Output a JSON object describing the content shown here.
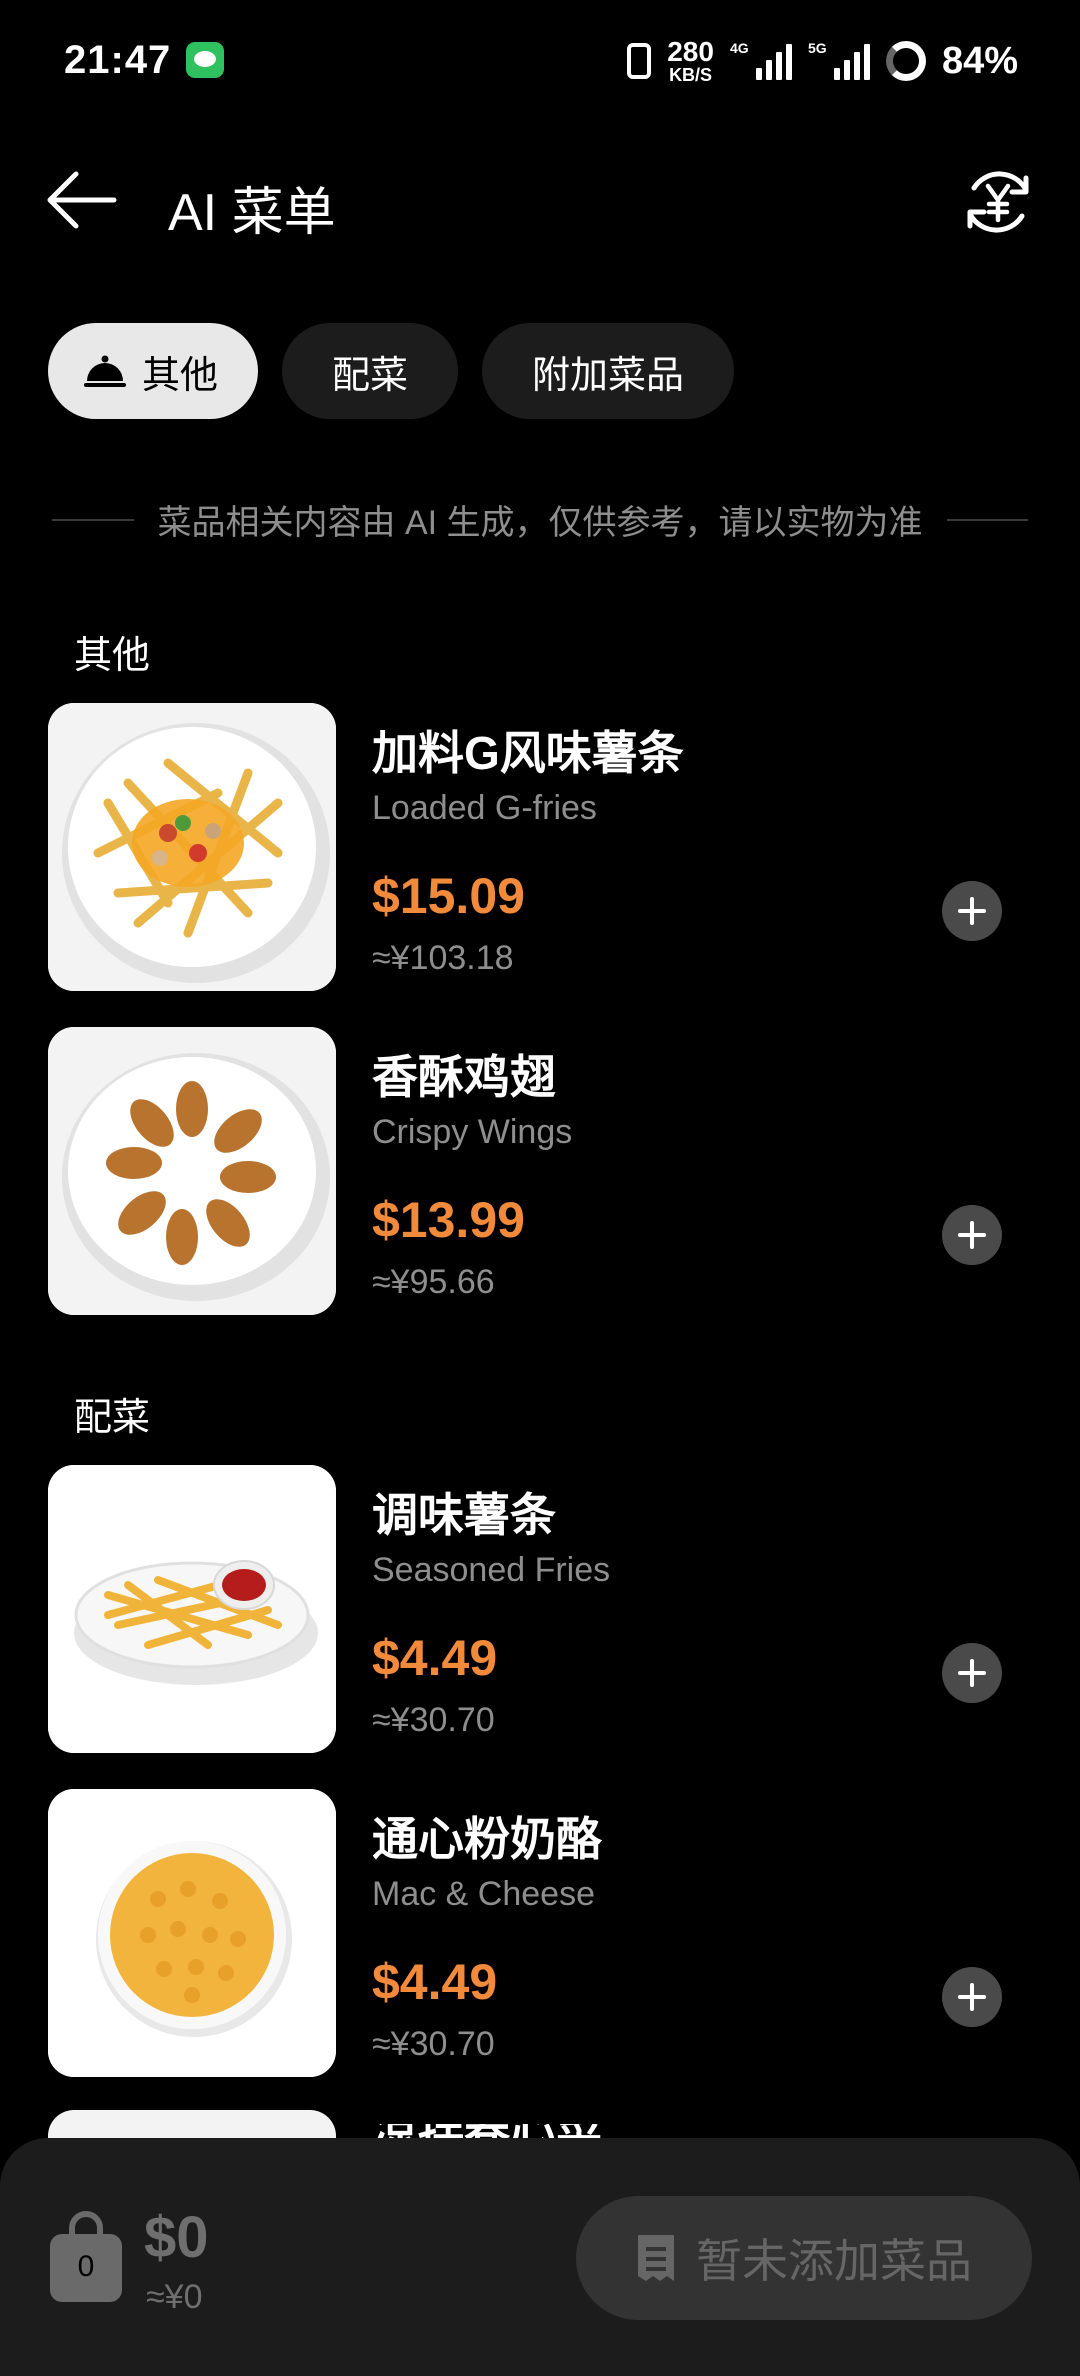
{
  "status_bar": {
    "time": "21:47",
    "net_speed": "280",
    "net_speed_unit": "KB/S",
    "sig1_label": "4G",
    "sig2_label": "5G",
    "battery": "84%"
  },
  "header": {
    "title": "AI 菜单"
  },
  "tabs": [
    {
      "label": "其他",
      "active": true
    },
    {
      "label": "配菜",
      "active": false
    },
    {
      "label": "附加菜品",
      "active": false
    }
  ],
  "notice": "菜品相关内容由 AI 生成，仅供参考，请以实物为准",
  "sections": [
    {
      "title": "其他",
      "items": [
        {
          "name": "加料G风味薯条",
          "en": "Loaded G-fries",
          "price": "$15.09",
          "cny": "≈¥103.18"
        },
        {
          "name": "香酥鸡翅",
          "en": "Crispy Wings",
          "price": "$13.99",
          "cny": "≈¥95.66"
        }
      ]
    },
    {
      "title": "配菜",
      "items": [
        {
          "name": "调味薯条",
          "en": "Seasoned Fries",
          "price": "$4.49",
          "cny": "≈¥30.70"
        },
        {
          "name": "通心粉奶酪",
          "en": "Mac & Cheese",
          "price": "$4.49",
          "cny": "≈¥30.70"
        },
        {
          "name": "凉拌卷心菜"
        }
      ]
    }
  ],
  "cart": {
    "count": "0",
    "total": "$0",
    "total_cny": "≈¥0",
    "submit_label": "暂未添加菜品"
  },
  "colors": {
    "accent_price": "#f28a3c",
    "background": "#000000",
    "panel": "#1c1c1c"
  }
}
